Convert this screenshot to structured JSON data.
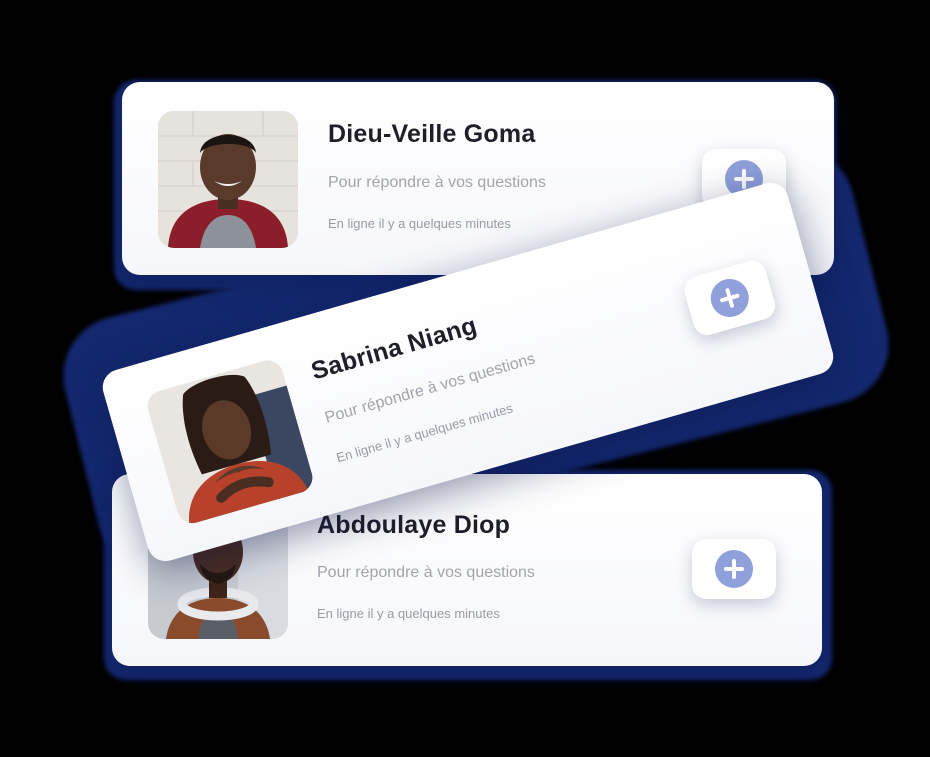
{
  "contacts": [
    {
      "name": "Dieu-Veille Goma",
      "subtitle": "Pour répondre à vos questions",
      "status": "En ligne il y a quelques minutes",
      "avatar_icon": "person-photo"
    },
    {
      "name": "Sabrina Niang",
      "subtitle": "Pour répondre à vos questions",
      "status": "En ligne il y a quelques minutes",
      "avatar_icon": "person-photo"
    },
    {
      "name": "Abdoulaye Diop",
      "subtitle": "Pour répondre à vos questions",
      "status": "En ligne il y a quelques minutes",
      "avatar_icon": "person-photo"
    }
  ],
  "add_button_icon": "plus-circle-icon",
  "colors": {
    "backdrop": "#14286f",
    "card": "#ffffff",
    "accent": "#8fa0da",
    "name_text": "#1f1f2a",
    "muted_text": "#a3a3ad"
  }
}
